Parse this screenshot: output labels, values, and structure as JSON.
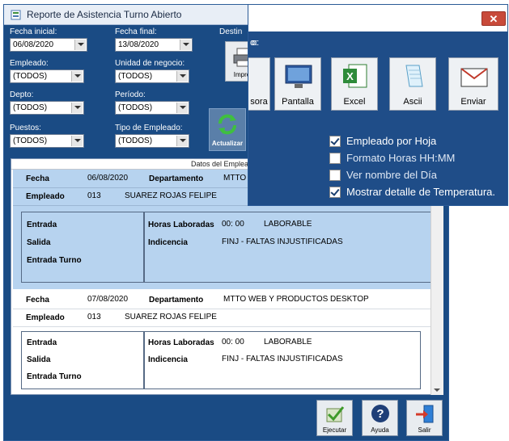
{
  "window": {
    "title": "Reporte de Asistencia Turno Abierto"
  },
  "filters": {
    "fecha_inicial": {
      "label": "Fecha inicial:",
      "value": "06/08/2020"
    },
    "fecha_final": {
      "label": "Fecha final:",
      "value": "13/08/2020"
    },
    "destino": {
      "label": "Destin"
    },
    "empleado": {
      "label": "Empleado:",
      "value": "(TODOS)"
    },
    "unidad": {
      "label": "Unidad de negocio:",
      "value": "(TODOS)"
    },
    "depto": {
      "label": "Depto:",
      "value": "(TODOS)"
    },
    "periodo": {
      "label": "Período:",
      "value": "(TODOS)"
    },
    "puestos": {
      "label": "Puestos:",
      "value": "(TODOS)"
    },
    "tipo_empleado": {
      "label": "Tipo de Empleado:",
      "value": "(TODOS)"
    },
    "actualizar_label": "Actualizar",
    "impresora_label": "Impre"
  },
  "content": {
    "section_header": "Datos del Emplea",
    "records": [
      {
        "fecha_label": "Fecha",
        "fecha": "06/08/2020",
        "depto_label": "Departamento",
        "depto": "MTTO W",
        "empleado_label": "Empleado",
        "num": "013",
        "nombre": "SUAREZ ROJAS FELIPE",
        "entrada_label": "Entrada",
        "salida_label": "Salida",
        "entrada_turno_label": "Entrada Turno",
        "horas_label": "Horas Laboradas",
        "horas": "00: 00",
        "tipo": "LABORABLE",
        "indicencia_label": "Indicencia",
        "indicencia": "FINJ - FALTAS INJUSTIFICADAS"
      },
      {
        "fecha_label": "Fecha",
        "fecha": "07/08/2020",
        "depto_label": "Departamento",
        "depto": "MTTO WEB Y PRODUCTOS DESKTOP",
        "empleado_label": "Empleado",
        "num": "013",
        "nombre": "SUAREZ ROJAS FELIPE",
        "entrada_label": "Entrada",
        "salida_label": "Salida",
        "entrada_turno_label": "Entrada Turno",
        "horas_label": "Horas Laboradas",
        "horas": "00: 00",
        "tipo": "LABORABLE",
        "indicencia_label": "Indicencia",
        "indicencia": "FINJ - FALTAS INJUSTIFICADAS"
      }
    ]
  },
  "bottom": {
    "ejecutar": "Ejecutar",
    "ayuda": "Ayuda",
    "salir": "Salir"
  },
  "options_panel": {
    "title_fragment": "o:",
    "close": "✕",
    "buttons": [
      "sora",
      "Pantalla",
      "Excel",
      "Ascii",
      "Enviar"
    ],
    "checks": [
      {
        "label": "Empleado por Hoja",
        "checked": true
      },
      {
        "label": "Formato Horas HH:MM",
        "checked": false
      },
      {
        "label": "Ver nombre del Día",
        "checked": false
      },
      {
        "label": "Mostrar detalle de Temperatura.",
        "checked": true
      }
    ]
  },
  "colors": {
    "window_bg": "#1a4b84",
    "selected_record": "#b7d3ef",
    "close_button": "#c84a3a"
  }
}
